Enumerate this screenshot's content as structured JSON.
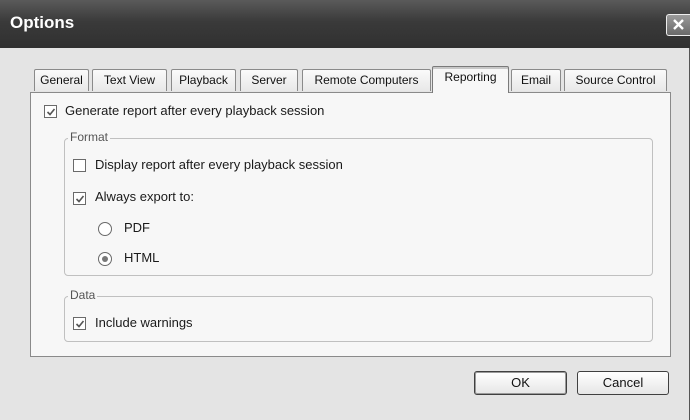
{
  "window": {
    "title": "Options"
  },
  "tabs": [
    {
      "label": "General",
      "active": false
    },
    {
      "label": "Text View",
      "active": false
    },
    {
      "label": "Playback",
      "active": false
    },
    {
      "label": "Server",
      "active": false
    },
    {
      "label": "Remote Computers",
      "active": false
    },
    {
      "label": "Reporting",
      "active": true
    },
    {
      "label": "Email",
      "active": false
    },
    {
      "label": "Source Control",
      "active": false
    }
  ],
  "reporting": {
    "generate_report": {
      "label": "Generate report after every playback session",
      "checked": true
    },
    "format": {
      "title": "Format",
      "display_report": {
        "label": "Display report after every playback session",
        "checked": false
      },
      "always_export": {
        "label": "Always export to:",
        "checked": true
      },
      "pdf": {
        "label": "PDF",
        "selected": false
      },
      "html": {
        "label": "HTML",
        "selected": true
      }
    },
    "data": {
      "title": "Data",
      "include_warnings": {
        "label": "Include warnings",
        "checked": true
      }
    }
  },
  "buttons": {
    "ok": "OK",
    "cancel": "Cancel"
  }
}
